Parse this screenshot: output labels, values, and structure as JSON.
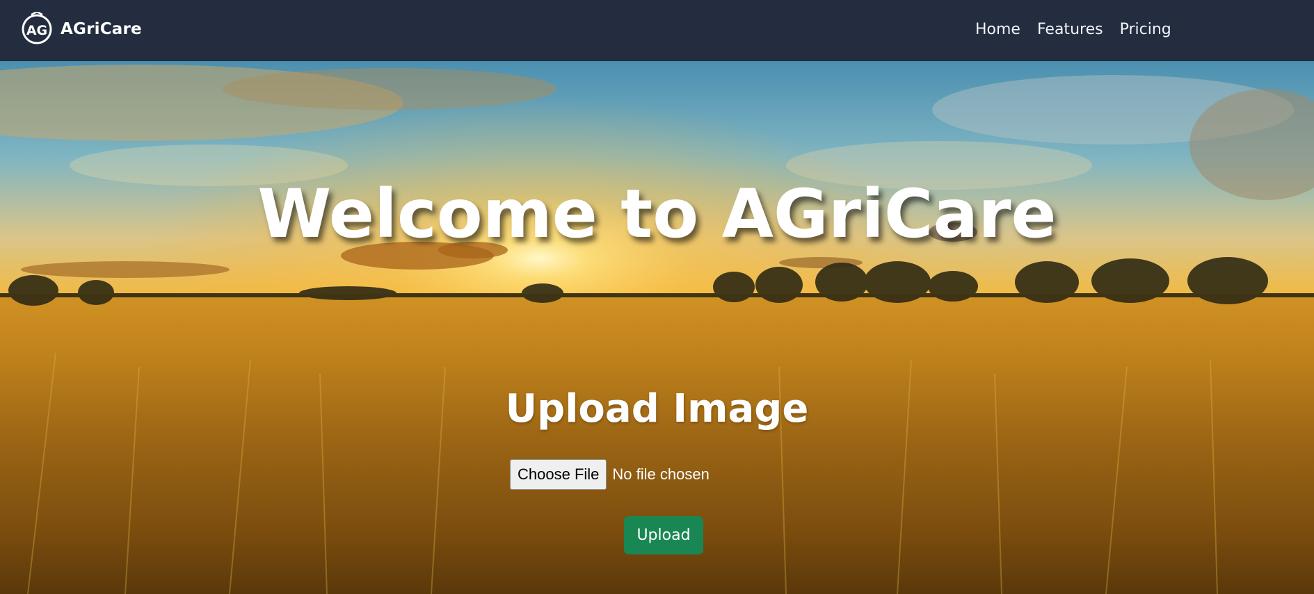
{
  "navbar": {
    "brand_name": "AGriCare",
    "logo_icon": "agricare-logo-icon",
    "links": [
      {
        "label": "Home"
      },
      {
        "label": "Features"
      },
      {
        "label": "Pricing"
      }
    ],
    "background_color": "#232d3f"
  },
  "hero": {
    "title": "Welcome to AGriCare",
    "background_image": "sunset-wheat-field"
  },
  "upload": {
    "heading": "Upload Image",
    "choose_file_label": "Choose File",
    "file_status": "No file chosen",
    "upload_button_label": "Upload",
    "upload_button_color": "#198754"
  }
}
